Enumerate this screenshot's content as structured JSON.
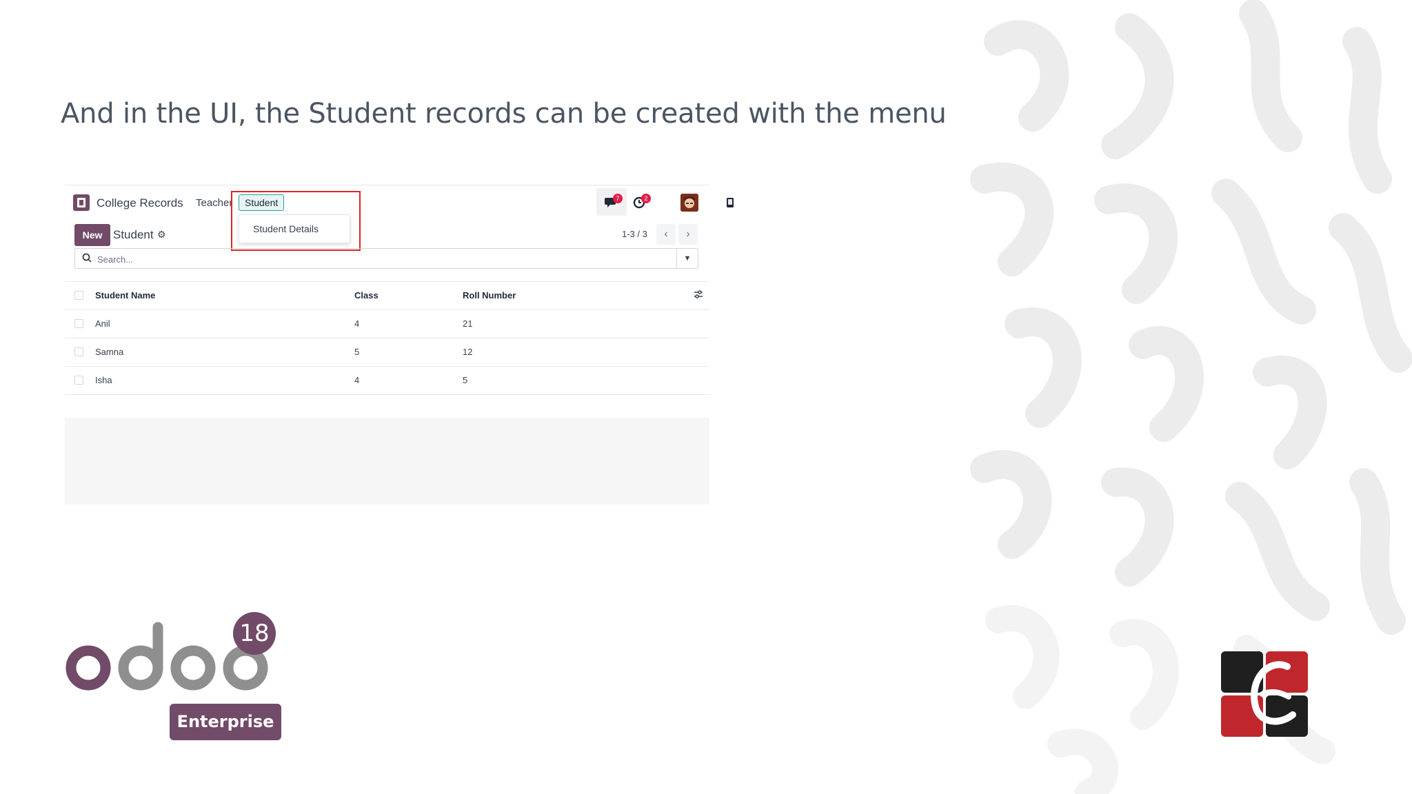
{
  "slide": {
    "title": "And in the UI, the Student records can be created with the menu"
  },
  "app": {
    "name": "College Records",
    "menus": [
      "Teacher",
      "Student"
    ],
    "active_menu": "Student",
    "dropdown_items": [
      "Student Details"
    ],
    "systray": {
      "messages_count": "7",
      "activities_count": "2"
    },
    "new_button_label": "New",
    "breadcrumb": "Student",
    "pager": "1-3 / 3",
    "search_placeholder": "Search...",
    "table": {
      "columns": [
        "Student Name",
        "Class",
        "Roll Number"
      ],
      "rows": [
        {
          "name": "Anil",
          "class": "4",
          "roll": "21"
        },
        {
          "name": "Samna",
          "class": "5",
          "roll": "12"
        },
        {
          "name": "Isha",
          "class": "4",
          "roll": "5"
        }
      ]
    }
  },
  "branding": {
    "product": "odoo",
    "version": "18",
    "edition": "Enterprise",
    "accent_color": "#714b67",
    "highlight_color": "#e02424"
  }
}
